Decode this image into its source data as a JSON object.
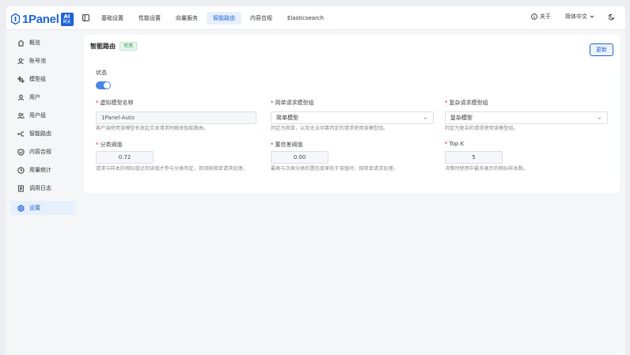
{
  "app": {
    "logo_text": "1Panel",
    "logo_badge_top": "AI",
    "logo_badge_bottom": "网关",
    "brand_color": "#1e63d6"
  },
  "topnav": {
    "tabs": [
      {
        "label": "基础设置",
        "active": false
      },
      {
        "label": "性能设置",
        "active": false
      },
      {
        "label": "向量服务",
        "active": false
      },
      {
        "label": "智能路由",
        "active": true
      },
      {
        "label": "内容合规",
        "active": false
      },
      {
        "label": "Elasticsearch",
        "active": false
      }
    ],
    "about_label": "关于",
    "language_label": "简体中文"
  },
  "sidebar": {
    "items": [
      {
        "label": "概览",
        "icon": "home-icon",
        "active": false
      },
      {
        "label": "账号池",
        "icon": "user-icon",
        "active": false
      },
      {
        "label": "模型组",
        "icon": "sparkle-icon",
        "active": false
      },
      {
        "label": "用户",
        "icon": "user-icon",
        "active": false
      },
      {
        "label": "用户组",
        "icon": "users-icon",
        "active": false
      },
      {
        "label": "智能路由",
        "icon": "route-icon",
        "active": false
      },
      {
        "label": "内容合规",
        "icon": "shield-icon",
        "active": false
      },
      {
        "label": "用量统计",
        "icon": "clock-icon",
        "active": false
      },
      {
        "label": "调用日志",
        "icon": "log-icon",
        "active": false
      },
      {
        "label": "设置",
        "icon": "gear-icon",
        "active": true
      }
    ]
  },
  "main": {
    "title": "智能路由",
    "status_badge": "可用",
    "update_button": "更新",
    "status_label": "状态",
    "status_enabled": true,
    "virtual_model": {
      "label": "虚拟模型名称",
      "value": "1Panel-Auto",
      "hint": "客户端使用该模型名发起文本请求时触发智能路由。"
    },
    "simple_group": {
      "label": "简单请求模型组",
      "value": "简单模型",
      "hint": "判定为简单，以及无法可靠判定的请求使用该模型组。"
    },
    "complex_group": {
      "label": "复杂请求模型组",
      "value": "复杂模型",
      "hint": "判定为复杂的请求使用该模型组。"
    },
    "classify_threshold": {
      "label": "分类阈值",
      "value": "0.72",
      "hint": "请求与样本的相似度达到该值才参与分类判定，否则按简单请求处理。"
    },
    "confidence_threshold": {
      "label": "置信差阈值",
      "value": "0.00",
      "hint": "最高与次高分类的置信度差低于该值时，按简单请求处理。"
    },
    "top_k": {
      "label": "Top K",
      "value": "5",
      "hint": "决策时使用中最多展示的相似样本数。"
    }
  }
}
